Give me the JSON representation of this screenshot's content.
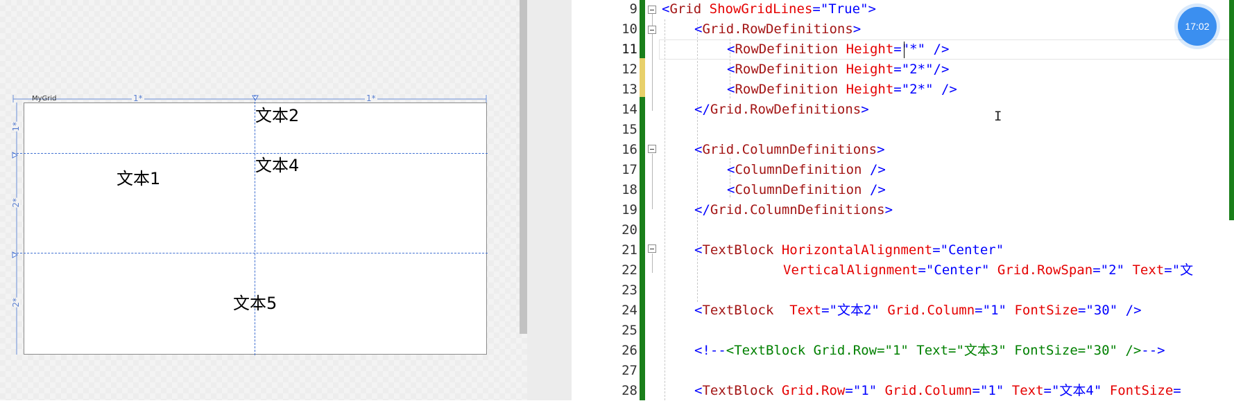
{
  "designer": {
    "grid_name": "MyGrid",
    "col_sizes": [
      "1*",
      "1*"
    ],
    "row_sizes": [
      "1*",
      "2*",
      "2*"
    ],
    "cells": [
      {
        "name": "cell-text-1",
        "text": "文本1"
      },
      {
        "name": "cell-text-2",
        "text": "文本2"
      },
      {
        "name": "cell-text-4",
        "text": "文本4"
      },
      {
        "name": "cell-text-5",
        "text": "文本5"
      }
    ]
  },
  "editor": {
    "active_line": "11",
    "lines": [
      {
        "n": "9",
        "segs": [
          [
            "br",
            "<"
          ],
          [
            "tag",
            "Grid"
          ],
          [
            "plain",
            " "
          ],
          [
            "attr",
            "ShowGridLines"
          ],
          [
            "br",
            "="
          ],
          [
            "q",
            "\""
          ],
          [
            "val",
            "True"
          ],
          [
            "q",
            "\""
          ],
          [
            "br",
            ">"
          ]
        ]
      },
      {
        "n": "10",
        "segs": [
          [
            "br",
            "<"
          ],
          [
            "tag",
            "Grid.RowDefinitions"
          ],
          [
            "br",
            ">"
          ]
        ]
      },
      {
        "n": "11",
        "segs": [
          [
            "br",
            "<"
          ],
          [
            "tag",
            "RowDefinition"
          ],
          [
            "plain",
            " "
          ],
          [
            "attr",
            "Height"
          ],
          [
            "br",
            "="
          ],
          [
            "q",
            "\""
          ],
          [
            "val",
            "*"
          ],
          [
            "q",
            "\""
          ],
          [
            "plain",
            " "
          ],
          [
            "br",
            "/>"
          ]
        ]
      },
      {
        "n": "12",
        "segs": [
          [
            "br",
            "<"
          ],
          [
            "tag",
            "RowDefinition"
          ],
          [
            "plain",
            " "
          ],
          [
            "attr",
            "Height"
          ],
          [
            "br",
            "="
          ],
          [
            "q",
            "\""
          ],
          [
            "val",
            "2*"
          ],
          [
            "q",
            "\""
          ],
          [
            "br",
            "/>"
          ]
        ]
      },
      {
        "n": "13",
        "segs": [
          [
            "br",
            "<"
          ],
          [
            "tag",
            "RowDefinition"
          ],
          [
            "plain",
            " "
          ],
          [
            "attr",
            "Height"
          ],
          [
            "br",
            "="
          ],
          [
            "q",
            "\""
          ],
          [
            "val",
            "2*"
          ],
          [
            "q",
            "\""
          ],
          [
            "plain",
            " "
          ],
          [
            "br",
            "/>"
          ]
        ]
      },
      {
        "n": "14",
        "segs": [
          [
            "br",
            "</"
          ],
          [
            "tag",
            "Grid.RowDefinitions"
          ],
          [
            "br",
            ">"
          ]
        ]
      },
      {
        "n": "15",
        "segs": []
      },
      {
        "n": "16",
        "segs": [
          [
            "br",
            "<"
          ],
          [
            "tag",
            "Grid.ColumnDefinitions"
          ],
          [
            "br",
            ">"
          ]
        ]
      },
      {
        "n": "17",
        "segs": [
          [
            "br",
            "<"
          ],
          [
            "tag",
            "ColumnDefinition"
          ],
          [
            "plain",
            " "
          ],
          [
            "br",
            "/>"
          ]
        ]
      },
      {
        "n": "18",
        "segs": [
          [
            "br",
            "<"
          ],
          [
            "tag",
            "ColumnDefinition"
          ],
          [
            "plain",
            " "
          ],
          [
            "br",
            "/>"
          ]
        ]
      },
      {
        "n": "19",
        "segs": [
          [
            "br",
            "</"
          ],
          [
            "tag",
            "Grid.ColumnDefinitions"
          ],
          [
            "br",
            ">"
          ]
        ]
      },
      {
        "n": "20",
        "segs": []
      },
      {
        "n": "21",
        "segs": [
          [
            "br",
            "<"
          ],
          [
            "tag",
            "TextBlock"
          ],
          [
            "plain",
            " "
          ],
          [
            "attr",
            "HorizontalAlignment"
          ],
          [
            "br",
            "="
          ],
          [
            "q",
            "\""
          ],
          [
            "val",
            "Center"
          ],
          [
            "q",
            "\""
          ]
        ]
      },
      {
        "n": "22",
        "segs": [
          [
            "attr",
            "VerticalAlignment"
          ],
          [
            "br",
            "="
          ],
          [
            "q",
            "\""
          ],
          [
            "val",
            "Center"
          ],
          [
            "q",
            "\""
          ],
          [
            "plain",
            " "
          ],
          [
            "attr",
            "Grid.RowSpan"
          ],
          [
            "br",
            "="
          ],
          [
            "q",
            "\""
          ],
          [
            "val",
            "2"
          ],
          [
            "q",
            "\""
          ],
          [
            "plain",
            " "
          ],
          [
            "attr",
            "Text"
          ],
          [
            "br",
            "="
          ],
          [
            "q",
            "\""
          ],
          [
            "val",
            "文"
          ]
        ]
      },
      {
        "n": "23",
        "segs": []
      },
      {
        "n": "24",
        "segs": [
          [
            "br",
            "<"
          ],
          [
            "tag",
            "TextBlock"
          ],
          [
            "plain",
            "  "
          ],
          [
            "attr",
            "Text"
          ],
          [
            "br",
            "="
          ],
          [
            "q",
            "\""
          ],
          [
            "val",
            "文本2"
          ],
          [
            "q",
            "\""
          ],
          [
            "plain",
            " "
          ],
          [
            "attr",
            "Grid.Column"
          ],
          [
            "br",
            "="
          ],
          [
            "q",
            "\""
          ],
          [
            "val",
            "1"
          ],
          [
            "q",
            "\""
          ],
          [
            "plain",
            " "
          ],
          [
            "attr",
            "FontSize"
          ],
          [
            "br",
            "="
          ],
          [
            "q",
            "\""
          ],
          [
            "val",
            "30"
          ],
          [
            "q",
            "\""
          ],
          [
            "plain",
            " "
          ],
          [
            "br",
            "/>"
          ]
        ]
      },
      {
        "n": "25",
        "segs": []
      },
      {
        "n": "26",
        "segs": [
          [
            "br",
            "<!--"
          ],
          [
            "cmt",
            "<TextBlock Grid.Row=\"1\" Text=\"文本3\" FontSize=\"30\" />"
          ],
          [
            "br",
            "-->"
          ]
        ]
      },
      {
        "n": "27",
        "segs": []
      },
      {
        "n": "28",
        "segs": [
          [
            "br",
            "<"
          ],
          [
            "tag",
            "TextBlock"
          ],
          [
            "plain",
            " "
          ],
          [
            "attr",
            "Grid.Row"
          ],
          [
            "br",
            "="
          ],
          [
            "q",
            "\""
          ],
          [
            "val",
            "1"
          ],
          [
            "q",
            "\""
          ],
          [
            "plain",
            " "
          ],
          [
            "attr",
            "Grid.Column"
          ],
          [
            "br",
            "="
          ],
          [
            "q",
            "\""
          ],
          [
            "val",
            "1"
          ],
          [
            "q",
            "\""
          ],
          [
            "plain",
            " "
          ],
          [
            "attr",
            "Text"
          ],
          [
            "br",
            "="
          ],
          [
            "q",
            "\""
          ],
          [
            "val",
            "文本4"
          ],
          [
            "q",
            "\""
          ],
          [
            "plain",
            " "
          ],
          [
            "attr",
            "FontSize"
          ],
          [
            "br",
            "="
          ]
        ]
      }
    ]
  },
  "clock": "17:02"
}
